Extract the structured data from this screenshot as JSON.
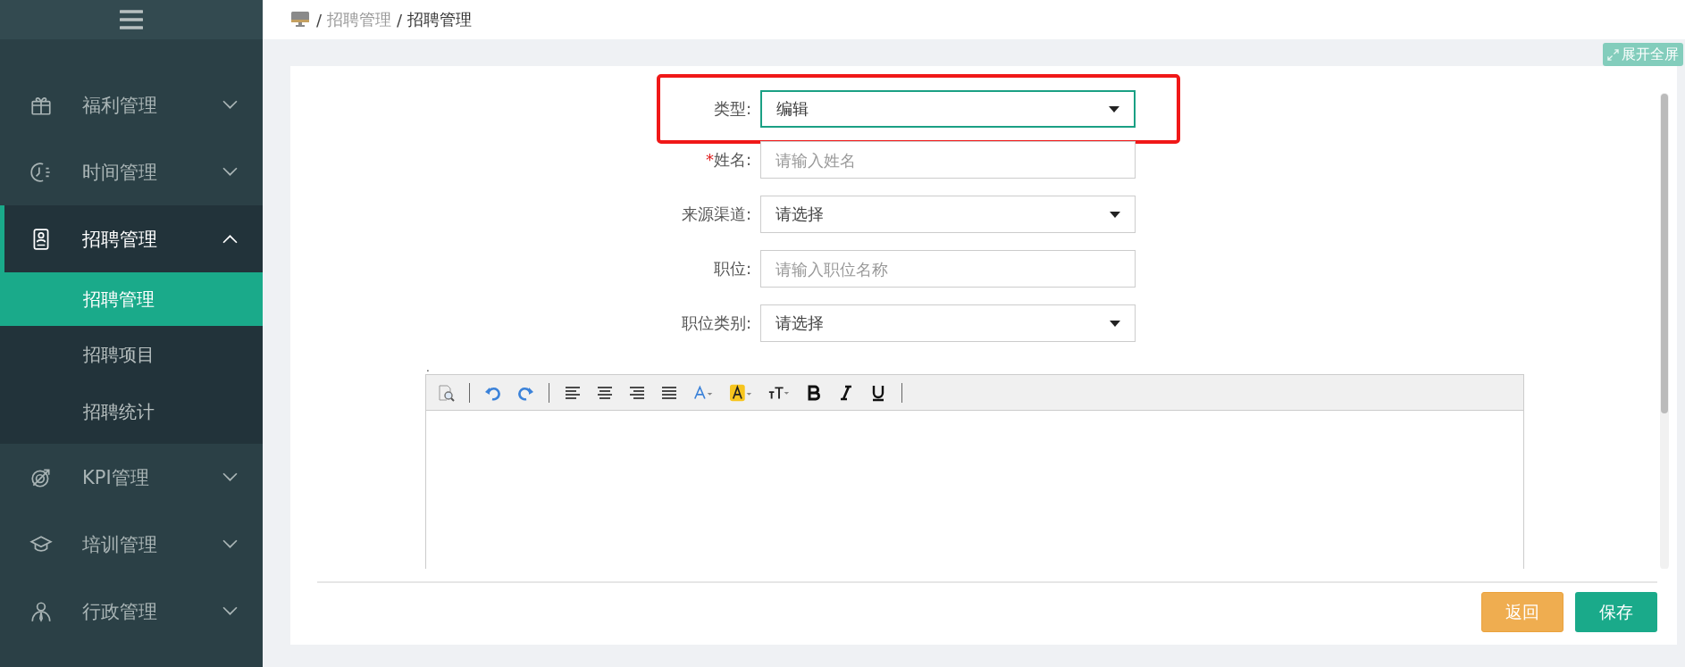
{
  "sidebar": {
    "items": [
      {
        "label": "福利管理",
        "expanded": false,
        "selected": false
      },
      {
        "label": "时间管理",
        "expanded": false,
        "selected": false
      },
      {
        "label": "招聘管理",
        "expanded": true,
        "selected": true,
        "children": [
          {
            "label": "招聘管理",
            "selected": true
          },
          {
            "label": "招聘项目",
            "selected": false
          },
          {
            "label": "招聘统计",
            "selected": false
          }
        ]
      },
      {
        "label": "KPI管理",
        "expanded": false,
        "selected": false
      },
      {
        "label": "培训管理",
        "expanded": false,
        "selected": false
      },
      {
        "label": "行政管理",
        "expanded": false,
        "selected": false
      }
    ]
  },
  "breadcrumb": [
    {
      "separator": "/",
      "label": "招聘管理",
      "current": false
    },
    {
      "separator": "/",
      "label": "招聘管理",
      "current": true
    }
  ],
  "fullscreen_button": "展开全屏",
  "form": {
    "fields": [
      {
        "label": "类型:",
        "kind": "select",
        "value": "编辑",
        "highlighted": true
      },
      {
        "marker": "*",
        "label": "姓名:",
        "kind": "text",
        "placeholder": "请输入姓名",
        "highlighted": false
      },
      {
        "label": "来源渠道:",
        "kind": "select",
        "placeholder": "请选择",
        "highlighted": false
      },
      {
        "label": "职位:",
        "kind": "text",
        "placeholder": "请输入职位名称",
        "highlighted": false
      },
      {
        "label": "职位类别:",
        "kind": "select",
        "placeholder": "请选择",
        "highlighted": false
      }
    ],
    "editor_label": "."
  },
  "buttons": [
    {
      "label": "返回",
      "kind": "back"
    },
    {
      "label": "保存",
      "kind": "save"
    }
  ]
}
